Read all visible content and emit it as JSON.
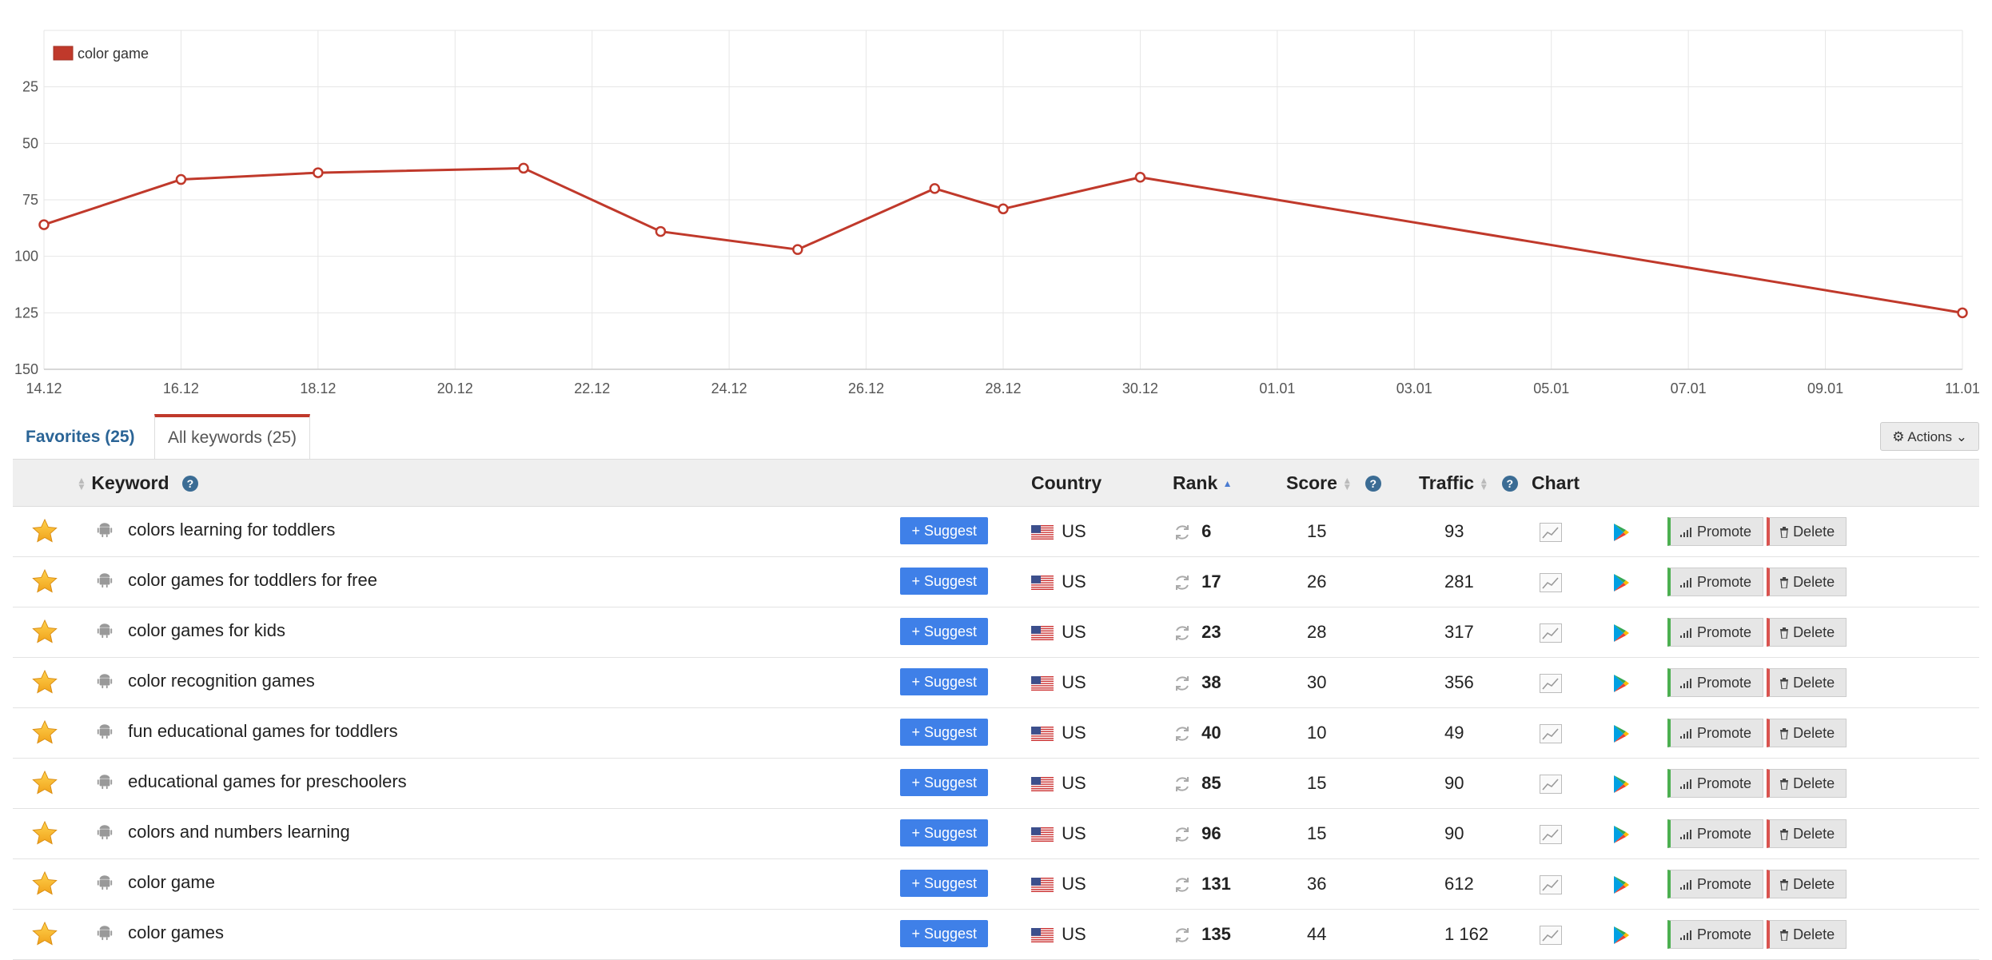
{
  "chart_data": {
    "type": "line",
    "series": [
      {
        "name": "color game",
        "color": "#c0392b",
        "points": [
          {
            "x": "14.12",
            "y": 86
          },
          {
            "x": "16.12",
            "y": 66
          },
          {
            "x": "18.12",
            "y": 63
          },
          {
            "x": "21.12",
            "y": 61
          },
          {
            "x": "23.12",
            "y": 89
          },
          {
            "x": "25.12",
            "y": 97
          },
          {
            "x": "27.12",
            "y": 70
          },
          {
            "x": "28.12",
            "y": 79
          },
          {
            "x": "30.12",
            "y": 65
          },
          {
            "x": "11.01",
            "y": 125
          }
        ]
      }
    ],
    "x_ticks": [
      "14.12",
      "16.12",
      "18.12",
      "20.12",
      "22.12",
      "24.12",
      "26.12",
      "28.12",
      "30.12",
      "01.01",
      "03.01",
      "05.01",
      "07.01",
      "09.01",
      "11.01"
    ],
    "y_ticks": [
      25,
      50,
      75,
      100,
      125,
      150
    ],
    "ylim": [
      150,
      0
    ],
    "y_reversed": true,
    "grid": true,
    "legend_position": "top-left"
  },
  "tabs": {
    "favorites": "Favorites (25)",
    "all": "All keywords (25)",
    "actions": "Actions"
  },
  "table": {
    "headers": {
      "keyword": "Keyword",
      "country": "Country",
      "rank": "Rank",
      "score": "Score",
      "traffic": "Traffic",
      "chart": "Chart"
    },
    "labels": {
      "suggest": "+ Suggest",
      "promote": "Promote",
      "delete": "Delete"
    },
    "rows": [
      {
        "keyword": "colors learning for toddlers",
        "country": "US",
        "rank": "6",
        "score": "15",
        "traffic": "93"
      },
      {
        "keyword": "color games for toddlers for free",
        "country": "US",
        "rank": "17",
        "score": "26",
        "traffic": "281"
      },
      {
        "keyword": "color games for kids",
        "country": "US",
        "rank": "23",
        "score": "28",
        "traffic": "317"
      },
      {
        "keyword": "color recognition games",
        "country": "US",
        "rank": "38",
        "score": "30",
        "traffic": "356"
      },
      {
        "keyword": "fun educational games for toddlers",
        "country": "US",
        "rank": "40",
        "score": "10",
        "traffic": "49"
      },
      {
        "keyword": "educational games for preschoolers",
        "country": "US",
        "rank": "85",
        "score": "15",
        "traffic": "90"
      },
      {
        "keyword": "colors and numbers learning",
        "country": "US",
        "rank": "96",
        "score": "15",
        "traffic": "90"
      },
      {
        "keyword": "color game",
        "country": "US",
        "rank": "131",
        "score": "36",
        "traffic": "612"
      },
      {
        "keyword": "color games",
        "country": "US",
        "rank": "135",
        "score": "44",
        "traffic": "1 162"
      }
    ]
  }
}
